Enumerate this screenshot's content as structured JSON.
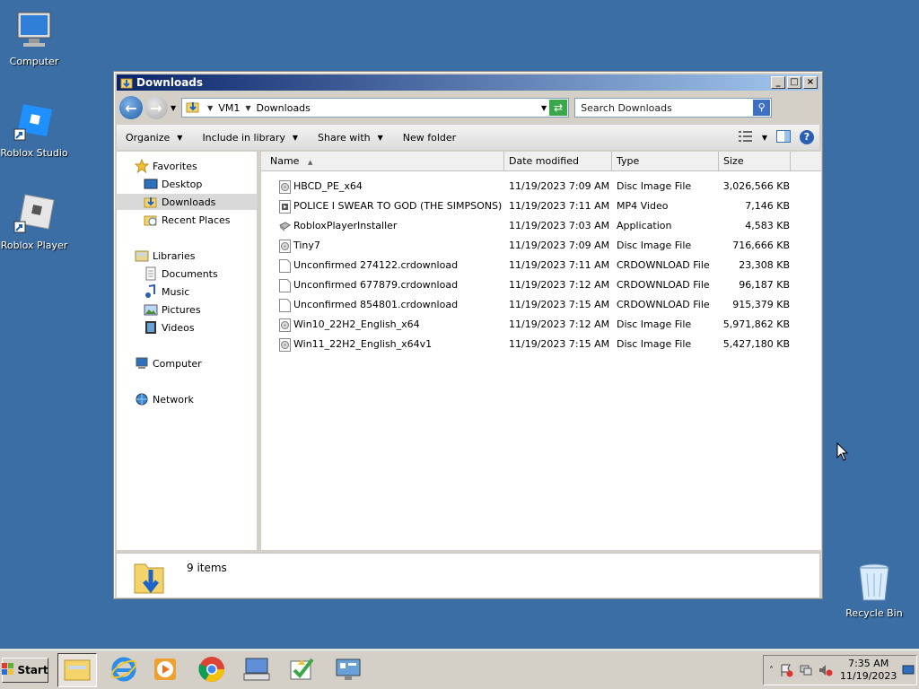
{
  "desktop": {
    "icons": [
      {
        "label": "Computer"
      },
      {
        "label": "Roblox Studio"
      },
      {
        "label": "Roblox Player"
      },
      {
        "label": "Recycle Bin"
      }
    ]
  },
  "window": {
    "title": "Downloads",
    "address": {
      "crumbs": [
        "VM1",
        "Downloads"
      ]
    },
    "search_placeholder": "Search Downloads",
    "commands": {
      "organize": "Organize",
      "include_in_library": "Include in library",
      "share_with": "Share with",
      "new_folder": "New folder"
    },
    "nav": {
      "favorites": "Favorites",
      "desktop": "Desktop",
      "downloads": "Downloads",
      "recent_places": "Recent Places",
      "libraries": "Libraries",
      "documents": "Documents",
      "music": "Music",
      "pictures": "Pictures",
      "videos": "Videos",
      "computer": "Computer",
      "network": "Network"
    },
    "columns": {
      "name": "Name",
      "date_modified": "Date modified",
      "type": "Type",
      "size": "Size"
    },
    "files": [
      {
        "name": "HBCD_PE_x64",
        "date": "11/19/2023 7:09 AM",
        "type": "Disc Image File",
        "size": "3,026,566 KB",
        "icon": "disc-image-icon"
      },
      {
        "name": "POLICE I SWEAR TO GOD (THE SIMPSONS) ...",
        "date": "11/19/2023 7:11 AM",
        "type": "MP4 Video",
        "size": "7,146 KB",
        "icon": "video-file-icon"
      },
      {
        "name": "RobloxPlayerInstaller",
        "date": "11/19/2023 7:03 AM",
        "type": "Application",
        "size": "4,583 KB",
        "icon": "application-icon"
      },
      {
        "name": "Tiny7",
        "date": "11/19/2023 7:09 AM",
        "type": "Disc Image File",
        "size": "716,666 KB",
        "icon": "disc-image-icon"
      },
      {
        "name": "Unconfirmed 274122.crdownload",
        "date": "11/19/2023 7:11 AM",
        "type": "CRDOWNLOAD File",
        "size": "23,308 KB",
        "icon": "blank-file-icon"
      },
      {
        "name": "Unconfirmed 677879.crdownload",
        "date": "11/19/2023 7:12 AM",
        "type": "CRDOWNLOAD File",
        "size": "96,187 KB",
        "icon": "blank-file-icon"
      },
      {
        "name": "Unconfirmed 854801.crdownload",
        "date": "11/19/2023 7:15 AM",
        "type": "CRDOWNLOAD File",
        "size": "915,379 KB",
        "icon": "blank-file-icon"
      },
      {
        "name": "Win10_22H2_English_x64",
        "date": "11/19/2023 7:12 AM",
        "type": "Disc Image File",
        "size": "5,971,862 KB",
        "icon": "disc-image-icon"
      },
      {
        "name": "Win11_22H2_English_x64v1",
        "date": "11/19/2023 7:15 AM",
        "type": "Disc Image File",
        "size": "5,427,180 KB",
        "icon": "disc-image-icon"
      }
    ],
    "status": {
      "item_count": "9 items"
    }
  },
  "taskbar": {
    "start_label": "Start",
    "clock_time": "7:35 AM",
    "clock_date": "11/19/2023"
  },
  "colors": {
    "desktop": "#3a6ea5",
    "title_start": "#0a246a",
    "title_end": "#a6caf0",
    "chrome": "#d4d0c8"
  }
}
